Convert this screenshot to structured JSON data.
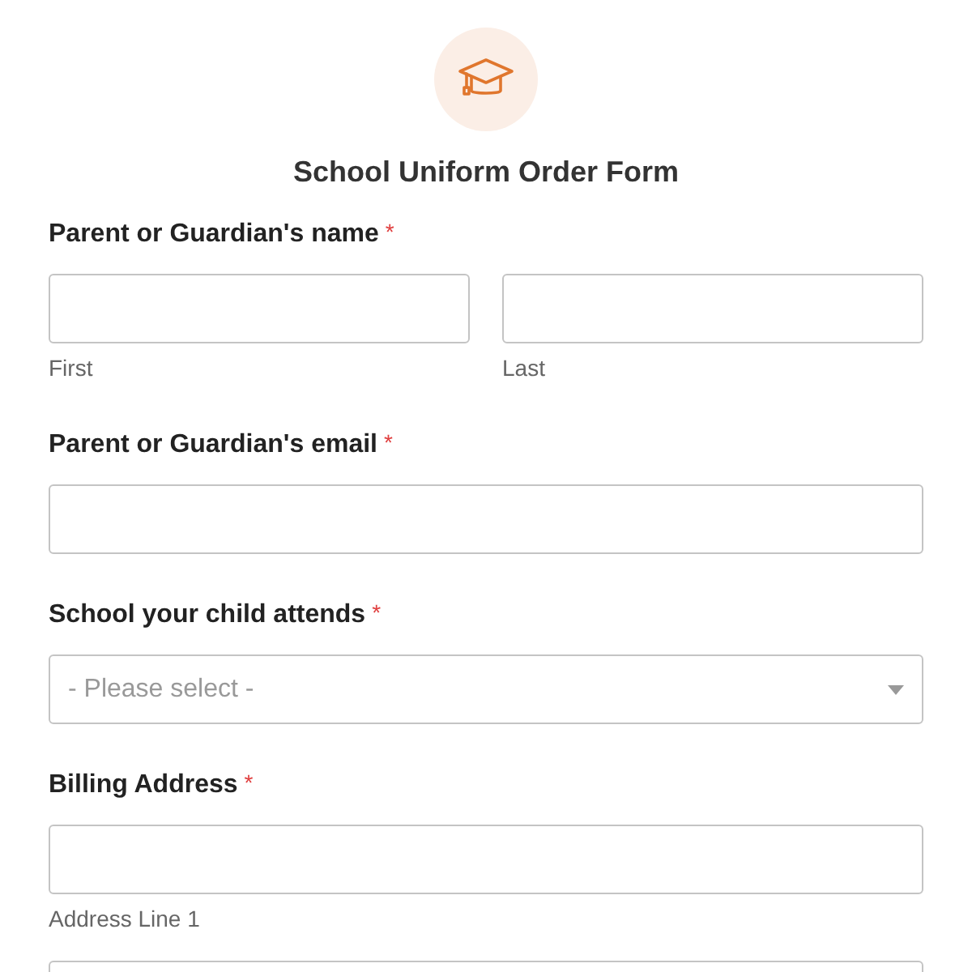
{
  "title": "School Uniform Order Form",
  "sections": [
    {
      "label": "Parent or Guardian's name",
      "required_mark": "*",
      "rows": [
        [
          {
            "kind": "text",
            "sublabel": "First"
          },
          {
            "kind": "text",
            "sublabel": "Last"
          }
        ]
      ]
    },
    {
      "label": "Parent or Guardian's email",
      "required_mark": "*",
      "rows": [
        [
          {
            "kind": "text"
          }
        ]
      ]
    },
    {
      "label": "School your child attends",
      "required_mark": "*",
      "rows": [
        [
          {
            "kind": "select",
            "placeholder": "- Please select -"
          }
        ]
      ]
    },
    {
      "label": "Billing Address",
      "required_mark": "*",
      "rows": [
        [
          {
            "kind": "text",
            "sublabel": "Address Line 1"
          }
        ],
        [
          {
            "kind": "text"
          }
        ]
      ]
    }
  ]
}
